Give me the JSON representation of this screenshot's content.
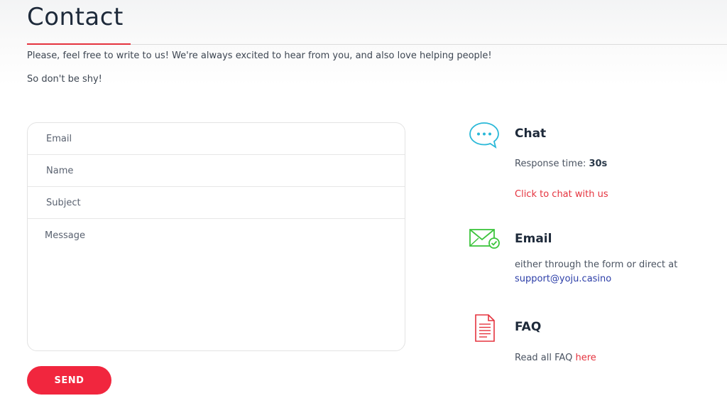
{
  "page": {
    "title": "Contact",
    "intro_line1": "Please, feel free to write to us! We're always excited to hear from you, and also love helping people!",
    "intro_line2": "So don't be shy!"
  },
  "form": {
    "email_placeholder": "Email",
    "name_placeholder": "Name",
    "subject_placeholder": "Subject",
    "message_placeholder": "Message",
    "send_label": "SEND"
  },
  "chat": {
    "icon": "chat-bubble-icon",
    "title": "Chat",
    "response_label": "Response time:",
    "response_value": "30s",
    "link": "Click to chat with us"
  },
  "email": {
    "icon": "envelope-check-icon",
    "title": "Email",
    "text": "either through the form or direct at",
    "address": "support@yoju.casino"
  },
  "faq": {
    "icon": "document-icon",
    "title": "FAQ",
    "text": "Read all FAQ",
    "link": "here"
  },
  "colors": {
    "accent_red": "#f1263e",
    "link_blue": "#2c3ea8",
    "chat_icon": "#29b8d8",
    "email_icon": "#3cc43c",
    "faq_icon": "#e5333e"
  }
}
